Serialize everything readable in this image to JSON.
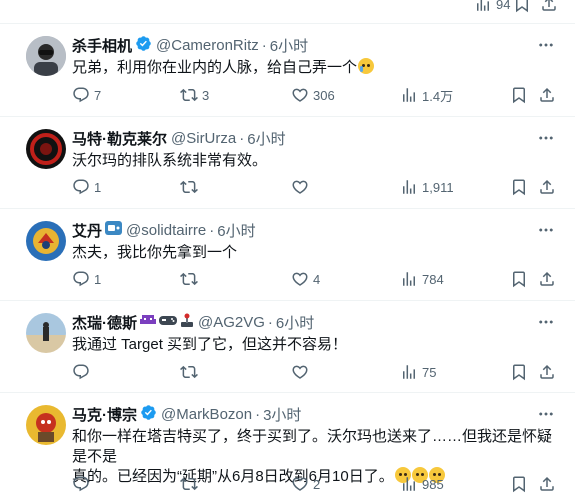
{
  "top_partial": {
    "views": "94"
  },
  "tweets": [
    {
      "name": "杀手相机",
      "handle": "@CameronRitz",
      "time": "6小时",
      "verified": true,
      "text": "兄弟，利用你在业内的人脉，给自己弄一个",
      "replies": "7",
      "retweets": "3",
      "likes": "306",
      "views": "1.4万"
    },
    {
      "name": "马特·勒克莱尔",
      "handle": "@SirUrza",
      "time": "6小时",
      "verified": false,
      "text": "沃尔玛的排队系统非常有效。",
      "replies": "1",
      "retweets": "",
      "likes": "",
      "views": "1,911"
    },
    {
      "name": "艾丹",
      "handle": "@solidtairre",
      "time": "6小时",
      "verified": false,
      "text": "杰夫，我比你先拿到一个",
      "replies": "1",
      "retweets": "",
      "likes": "4",
      "views": "784"
    },
    {
      "name": "杰瑞·德斯",
      "handle": "@AG2VG",
      "time": "6小时",
      "verified": false,
      "text": "我通过 Target 买到了它，但这并不容易！",
      "replies": "",
      "retweets": "",
      "likes": "",
      "views": "75"
    },
    {
      "name": "马克·博宗",
      "handle": "@MarkBozon",
      "time": "3小时",
      "verified": true,
      "text_line1": "和你一样在塔吉特买了，终于买到了。沃尔玛也送来了……但我还是怀疑是不是",
      "text_line2": "真的。已经因为“延期”从6月8日改到6月10日了。",
      "replies": "",
      "retweets": "",
      "likes": "2",
      "views": "985"
    }
  ],
  "colors": {
    "accent": "#1d9bf0",
    "muted": "#536471",
    "text": "#0f1419",
    "border": "#eff3f4"
  },
  "icons": [
    "reply-icon",
    "retweet-icon",
    "like-icon",
    "views-icon",
    "bookmark-icon",
    "share-icon",
    "more-icon",
    "verified-badge-icon"
  ]
}
